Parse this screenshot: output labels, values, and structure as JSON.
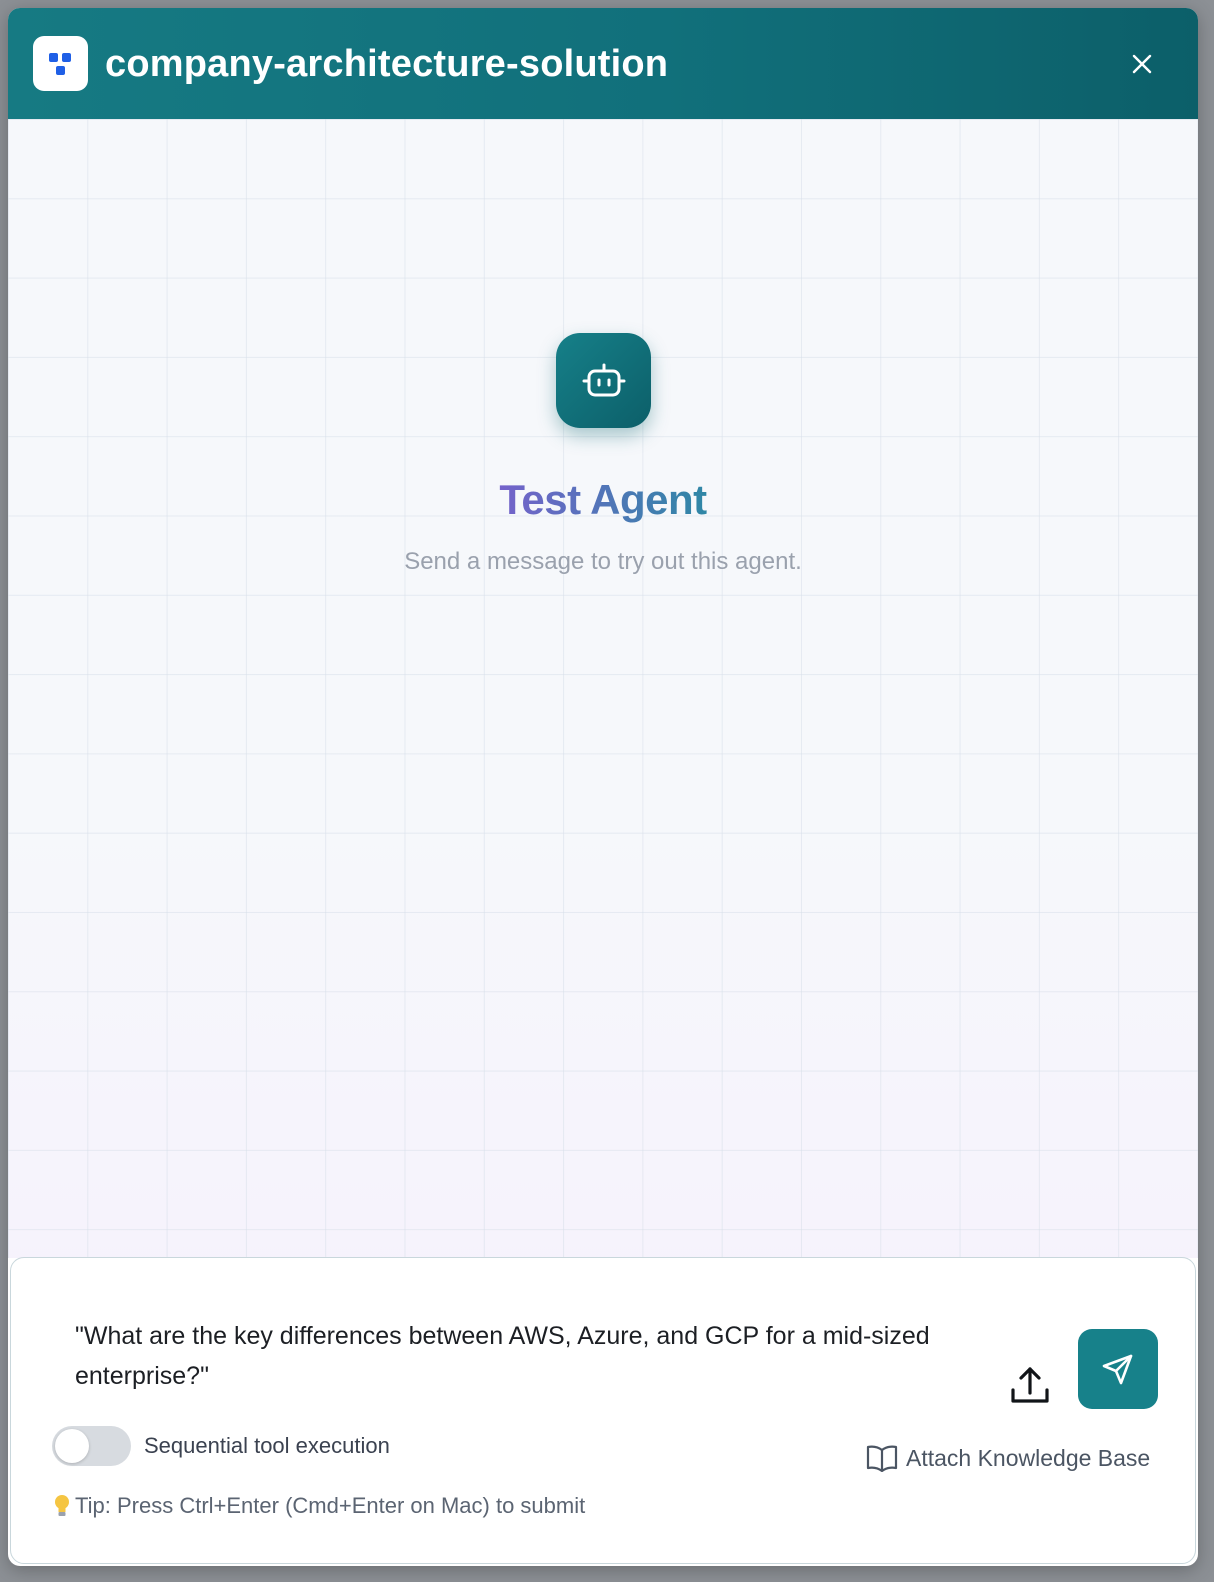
{
  "header": {
    "title": "company-architecture-solution",
    "logo_icon": "blocks-logo-icon",
    "close_icon": "close-icon"
  },
  "empty_state": {
    "icon": "robot-icon",
    "title": "Test Agent",
    "subtitle": "Send a message to try out this agent."
  },
  "composer": {
    "message_value": "\"What are the key differences between AWS, Azure, and GCP for a mid-sized enterprise?\"",
    "upload_icon": "upload-icon",
    "send_icon": "send-icon",
    "toggle_label": "Sequential tool execution",
    "toggle_on": false,
    "attach_kb_label": "Attach Knowledge Base",
    "attach_kb_icon": "book-open-icon",
    "tip_icon": "lightbulb-icon",
    "tip_text": "Tip: Press Ctrl+Enter (Cmd+Enter on Mac) to submit"
  },
  "colors": {
    "header_teal": "#167a83",
    "accent_teal": "#17818a",
    "logo_blue": "#1f5fe6",
    "title_gradient_start": "#d9489a",
    "title_gradient_mid": "#8d55d8"
  }
}
